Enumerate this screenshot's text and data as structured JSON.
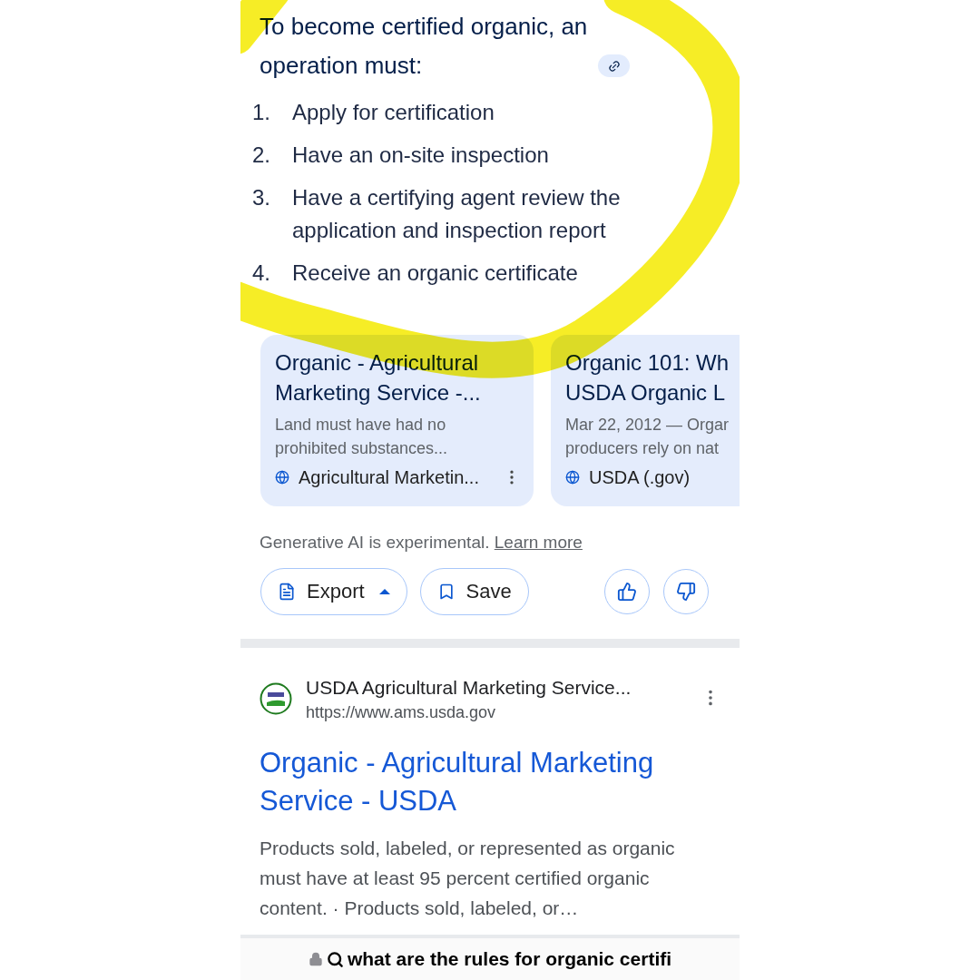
{
  "answer": {
    "heading": "To become certified organic, an operation must:",
    "steps": [
      {
        "number": "1.",
        "text": "Apply for certification"
      },
      {
        "number": "2.",
        "text": "Have an on-site inspection"
      },
      {
        "number": "3.",
        "text": "Have a certifying agent review the application and inspection report"
      },
      {
        "number": "4.",
        "text": "Receive an organic certificate"
      }
    ]
  },
  "source_cards": [
    {
      "title_lines": [
        "Organic - Agricultural",
        "Marketing Service -..."
      ],
      "snippet_lines": [
        "Land must have had no",
        "prohibited substances..."
      ],
      "source": "Agricultural Marketin...",
      "has_menu": true
    },
    {
      "title_lines": [
        "Organic 101: Wh",
        "USDA Organic L"
      ],
      "snippet_lines": [
        "Mar 22, 2012 — Orgar",
        "producers rely on nat"
      ],
      "source": "USDA (.gov)",
      "has_menu": false
    }
  ],
  "disclaimer": {
    "text": "Generative AI is experimental.",
    "link": "Learn more"
  },
  "actions": [
    {
      "kind": "export",
      "label": "Export"
    },
    {
      "kind": "save",
      "label": "Save"
    }
  ],
  "result": {
    "site_name": "USDA Agricultural Marketing Service...",
    "url": "https://www.ams.usda.gov",
    "title": "Organic - Agricultural Marketing Service - USDA",
    "snippet": "Products sold, labeled, or represented as organic must have at least 95 percent certified organic content. · Products sold, labeled, or…"
  },
  "address_bar": {
    "query": "what are the rules for organic certifi"
  }
}
